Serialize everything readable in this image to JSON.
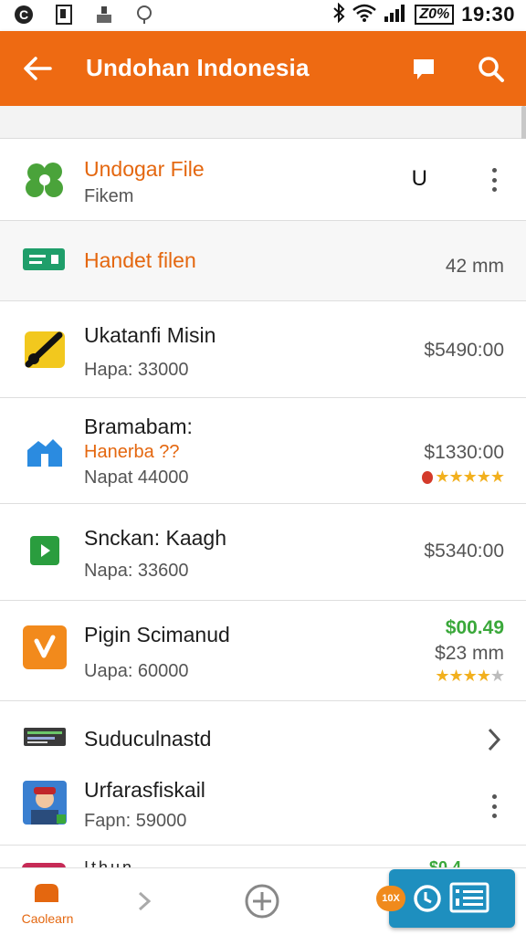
{
  "status_bar": {
    "time": "19:30",
    "battery": "Z0%",
    "icons": [
      "c-icon",
      "document-icon",
      "person-icon",
      "gps-icon",
      "bluetooth-icon",
      "wifi-icon",
      "signal-icon"
    ]
  },
  "app_bar": {
    "title": "Undohan Indonesia",
    "back_icon": "back-arrow-icon",
    "actions": [
      "comment-icon",
      "search-icon"
    ],
    "color": "#ee6a12"
  },
  "rows": [
    {
      "title": "Undogar File",
      "subtitle": "Fikem",
      "right": "U",
      "icon": "green-blob-icon",
      "has_menu": true
    },
    {
      "title": "Handet filen",
      "right": "42 mm",
      "icon": "message-icon"
    },
    {
      "title": "Ukatanfi Misin",
      "subtitle": "Hapa: 33000",
      "right": "$5490:00",
      "icon": "yellow-tool-icon"
    },
    {
      "title": "Bramabam:",
      "subtitle_orange": "Hanerba ??",
      "subtitle": "Napat 44000",
      "right": "$1330:00",
      "rating": 5,
      "icon": "blue-house-icon"
    },
    {
      "title": "Snckan: Kaagh",
      "subtitle": "Napa: 33600",
      "right": "$5340:00",
      "icon": "green-play-icon"
    },
    {
      "title": "Pigin Scimanud",
      "subtitle": "Uapa: 60000",
      "right_green": "$00.49",
      "right": "$23 mm",
      "rating": 4,
      "icon": "orange-app-icon"
    },
    {
      "title": "Suduculnastd",
      "icon": "list-bars-icon"
    },
    {
      "title": "Urfarasfiskail",
      "subtitle": "Fapn: 59000",
      "icon": "avatar-icon",
      "has_menu": true
    }
  ],
  "peek": {
    "text": "Ithun",
    "green": "$0.4"
  },
  "bottom_nav": {
    "home_label": "Caolearn",
    "fab_tag": "10X",
    "items": [
      "home-icon",
      "chevron-right-icon",
      "add-circle-icon"
    ]
  },
  "colors": {
    "accent": "#ee6a12",
    "green": "#3aa83a",
    "star": "#f2b01e",
    "fab": "#1e8fbf"
  }
}
